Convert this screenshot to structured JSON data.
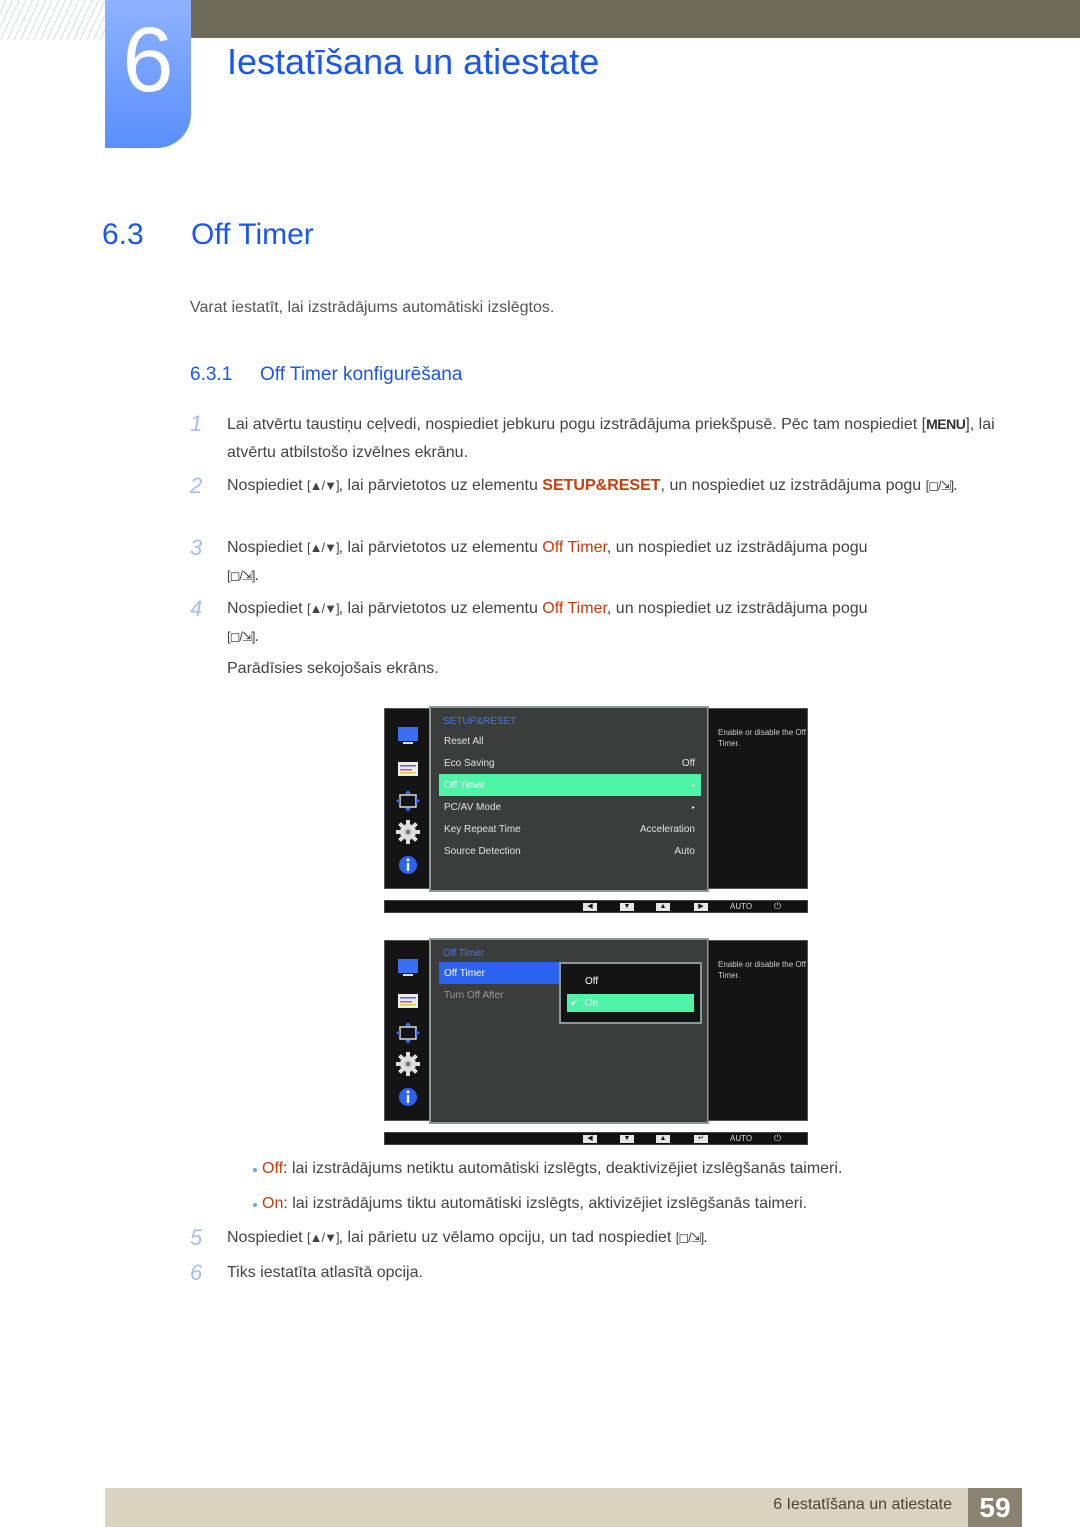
{
  "header": {
    "chapter_number": "6",
    "chapter_title": "Iestatīšana un atiestate"
  },
  "section": {
    "number": "6.3",
    "title": "Off Timer",
    "intro": "Varat iestatīt, lai izstrādājums automātiski izslēgtos."
  },
  "subsection": {
    "number": "6.3.1",
    "title": "Off Timer konfigurēšana"
  },
  "glyphs": {
    "up_down": "[▲/▼]",
    "source_enter": "[◻/⇲]",
    "menu": "MENU"
  },
  "steps": [
    {
      "n": "1",
      "pre": "Lai atvērtu taustiņu ceļvedi, nospiediet jebkuru pogu izstrādājuma priekšpusē. Pēc tam nospiediet ",
      "post": ", lai atvērtu atbilstošo izvēlnes ekrānu."
    },
    {
      "n": "2",
      "pre": "Nospiediet ",
      "mid": ", lai pārvietotos uz elementu ",
      "highlight": "SETUP&RESET",
      "post": ", un nospiediet uz izstrādājuma pogu "
    },
    {
      "n": "3",
      "pre": "Nospiediet ",
      "mid": ", lai pārvietotos uz elementu ",
      "highlight": "Off Timer",
      "post": ", un nospiediet uz izstrādājuma pogu "
    },
    {
      "n": "4",
      "pre": "Nospiediet ",
      "mid": ", lai pārvietotos uz elementu ",
      "highlight": "Off Timer",
      "post": ", un nospiediet uz izstrādājuma pogu "
    },
    {
      "n": "5",
      "pre": "Nospiediet ",
      "post": ", lai pārietu uz vēlamo opciju, un tad nospiediet "
    },
    {
      "n": "6",
      "text": "Tiks iestatīta atlasītā opcija."
    }
  ],
  "after_step4": "Parādīsies sekojošais ekrāns.",
  "osd1": {
    "title": "SETUP&RESET",
    "help": "Enable or disable the Off Timer.",
    "rows": [
      {
        "label": "Reset All",
        "value": ""
      },
      {
        "label": "Eco Saving",
        "value": "Off"
      },
      {
        "label": "Off Timer",
        "value": "▸",
        "selected": true
      },
      {
        "label": "PC/AV Mode",
        "value": "▸"
      },
      {
        "label": "Key Repeat Time",
        "value": "Acceleration"
      },
      {
        "label": "Source Detection",
        "value": "Auto"
      }
    ],
    "sidebar_icons": [
      "picture-icon",
      "onscreen-display-icon",
      "position-icon",
      "setup-gear-icon",
      "information-icon"
    ],
    "keys": [
      "◀",
      "▼",
      "▲",
      "▶"
    ],
    "auto_label": "AUTO",
    "power_glyph": "⏻"
  },
  "osd2": {
    "title": "Off Timer",
    "help": "Enable or disable the Off Timer.",
    "rows": [
      {
        "label": "Off Timer",
        "selected": true
      },
      {
        "label": "Turn Off After",
        "dimmed": true
      }
    ],
    "popup_options": [
      {
        "label": "Off",
        "checked": false
      },
      {
        "label": "On",
        "checked": true
      }
    ],
    "keys": [
      "◀",
      "▼",
      "▲",
      "↵"
    ],
    "auto_label": "AUTO",
    "power_glyph": "⏻",
    "check_glyph": "✔"
  },
  "bullets": [
    {
      "term": "Off",
      "text": ": lai izstrādājums netiktu automātiski izslēgts, deaktivizējiet izslēgšanās taimeri."
    },
    {
      "term": "On",
      "text": ": lai izstrādājums tiktu automātiski izslēgts, aktivizējiet izslēgšanās taimeri."
    }
  ],
  "footer": {
    "text": "6 Iestatīšana un atiestate",
    "page": "59"
  },
  "colors": {
    "heading_blue": "#1a57f0",
    "highlight_orange": "#c83d0a",
    "osd_selected_green": "#4ff5a7",
    "osd_selected_blue": "#2b62f0"
  }
}
